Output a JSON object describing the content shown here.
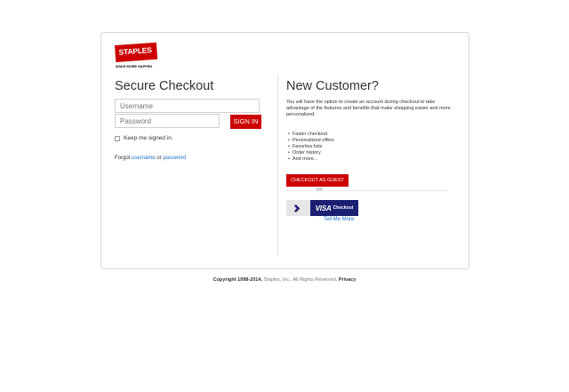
{
  "logo": {
    "brand": "STAPLES",
    "tagline": "MAKE MORE HAPPEN"
  },
  "login": {
    "title": "Secure Checkout",
    "username_placeholder": "Username",
    "password_placeholder": "Password",
    "signin_label": "SIGN IN",
    "keep_signed_in": "Keep me signed in.",
    "forgot_prefix": "Forgot",
    "forgot_username": "username",
    "forgot_or": "or",
    "forgot_password": "password"
  },
  "new_customer": {
    "title": "New Customer?",
    "description": "You will have the option to create an account during checkout to take advantage of the features and benefits that make shopping easier and more personalized.",
    "benefits": [
      "Faster checkout",
      "Personalized offers",
      "Favorites lists",
      "Order history",
      "And more..."
    ],
    "guest_label": "CHECKOUT AS GUEST",
    "or_label": "OR",
    "visa_brand": "VISA",
    "visa_word": "Checkout",
    "tell_me_more": "Tell Me More"
  },
  "footer": {
    "copyright": "Copyright 1998-2014,",
    "company": "Staples, Inc., All Rights Reserved.",
    "privacy": "Privacy"
  },
  "colors": {
    "accent": "#cc0000",
    "link": "#1a6fc9",
    "visa": "#1a1f71"
  },
  "icons": {
    "visa_arrow": "chevron-right-icon"
  }
}
